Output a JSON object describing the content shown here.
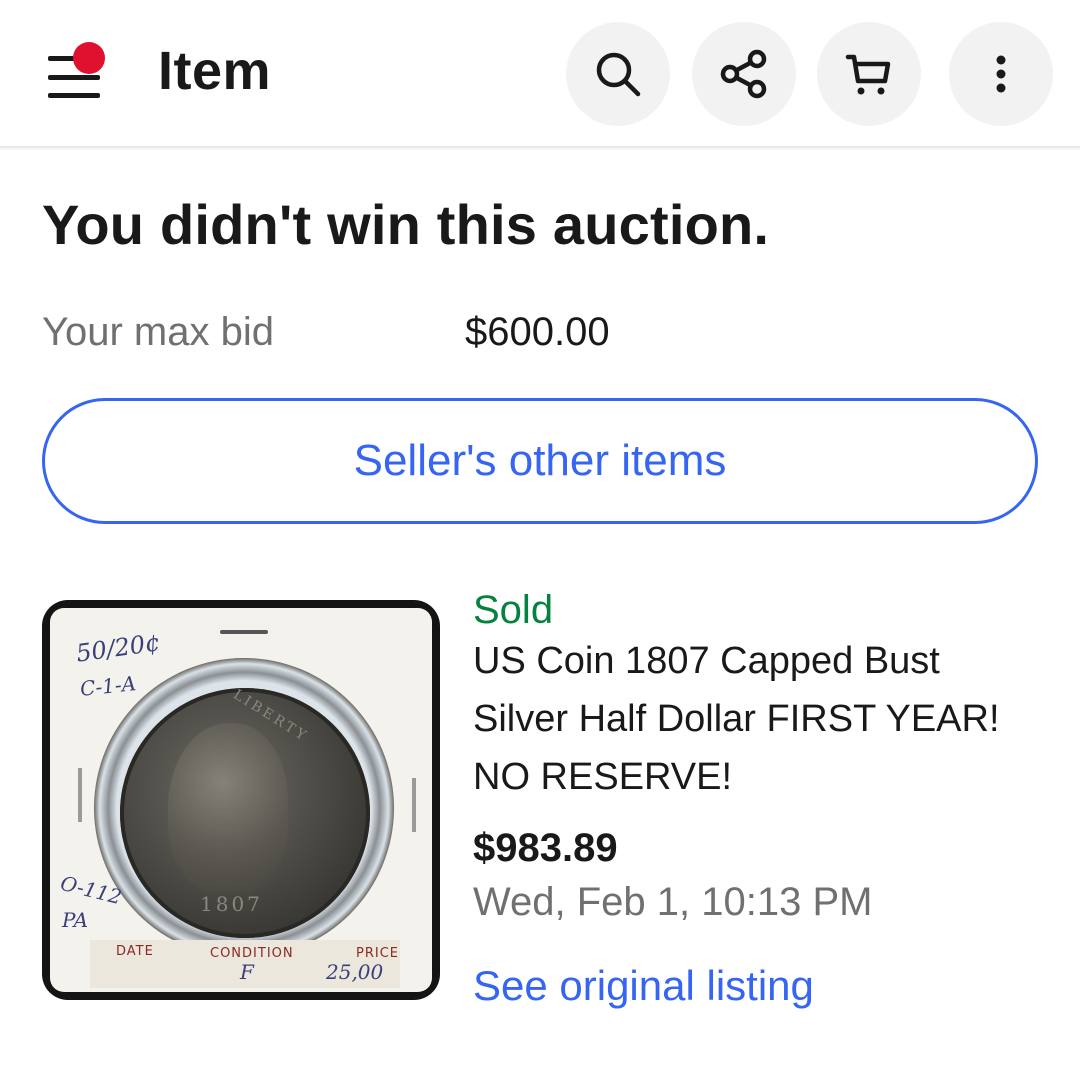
{
  "appbar": {
    "title": "Item",
    "icons": {
      "menu": "menu-icon",
      "notification": "notification-dot-icon",
      "search": "search-icon",
      "share": "share-icon",
      "cart": "cart-icon",
      "more": "more-vertical-icon"
    }
  },
  "auction": {
    "headline": "You didn't win this auction.",
    "max_bid_label": "Your max bid",
    "max_bid_value": "$600.00",
    "seller_button_label": "Seller's other items"
  },
  "item": {
    "status": "Sold",
    "title_lines": [
      "US Coin 1807 Capped Bust",
      "Silver Half Dollar FIRST YEAR!",
      "NO RESERVE!"
    ],
    "price": "$983.89",
    "end_date": "Wed, Feb 1, 10:13 PM",
    "see_listing_label": "See original listing",
    "image": {
      "handwriting_top": "50/20¢",
      "handwriting_grade": "C-1-A",
      "handwriting_variety": "O-112",
      "handwriting_variety2": "PA",
      "coin_date": "1807",
      "coin_legend": "LIBERTY",
      "strip_date_label": "DATE",
      "strip_condition_label": "CONDITION",
      "strip_price_label": "PRICE",
      "strip_condition_value": "F",
      "strip_price_value": "25,00"
    }
  },
  "colors": {
    "link_blue": "#3665f3",
    "sold_green": "#05823f",
    "notification_red": "#e0102f"
  }
}
